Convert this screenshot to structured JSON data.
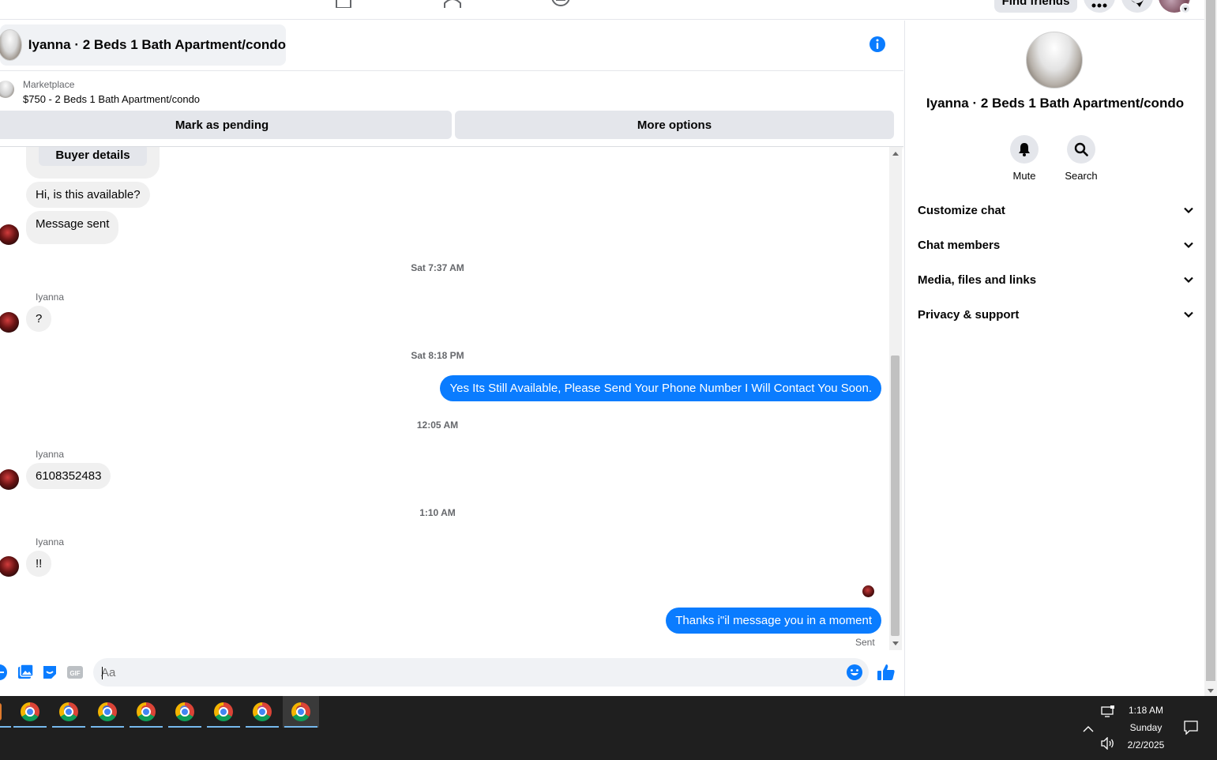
{
  "top_nav": {
    "find_friends_label": "Find friends"
  },
  "chat": {
    "title": "Iyanna · 2 Beds 1 Bath Apartment/condo",
    "marketplace": {
      "label": "Marketplace",
      "listing": "$750 - 2 Beds 1 Bath Apartment/condo",
      "mark_pending_label": "Mark as pending",
      "more_options_label": "More options"
    },
    "buyer_details_label": "Buyer details",
    "messages": [
      {
        "from": "them",
        "text": "Hi, is this available?"
      },
      {
        "from": "them",
        "text": "Message sent"
      },
      {
        "timestamp": "Sat 7:37 AM"
      },
      {
        "from": "them",
        "sender": "Iyanna",
        "text": "?"
      },
      {
        "timestamp": "Sat 8:18 PM"
      },
      {
        "from": "me",
        "text": "Yes Its Still Available, Please Send Your Phone Number I Will Contact You Soon."
      },
      {
        "timestamp": "12:05 AM"
      },
      {
        "from": "them",
        "sender": "Iyanna",
        "text": "6108352483"
      },
      {
        "timestamp": "1:10 AM"
      },
      {
        "from": "them",
        "sender": "Iyanna",
        "text": "!!"
      },
      {
        "from": "me",
        "text": "Thanks i\"il message you in a moment"
      }
    ],
    "sent_status": "Sent",
    "composer": {
      "placeholder": "Aa"
    }
  },
  "right_panel": {
    "name": "Iyanna · 2 Beds 1 Bath Apartment/condo",
    "actions": [
      {
        "label": "Mute",
        "icon": "bell-icon"
      },
      {
        "label": "Search",
        "icon": "search-icon"
      }
    ],
    "sections": [
      {
        "label": "Customize chat"
      },
      {
        "label": "Chat members"
      },
      {
        "label": "Media, files and links"
      },
      {
        "label": "Privacy & support"
      }
    ]
  },
  "taskbar": {
    "time": "1:18 AM",
    "day": "Sunday",
    "date": "2/2/2025"
  },
  "colors": {
    "accent": "#0a7cff",
    "bubble_in": "#f0f0f0",
    "taskbar": "#1f1f1f"
  }
}
